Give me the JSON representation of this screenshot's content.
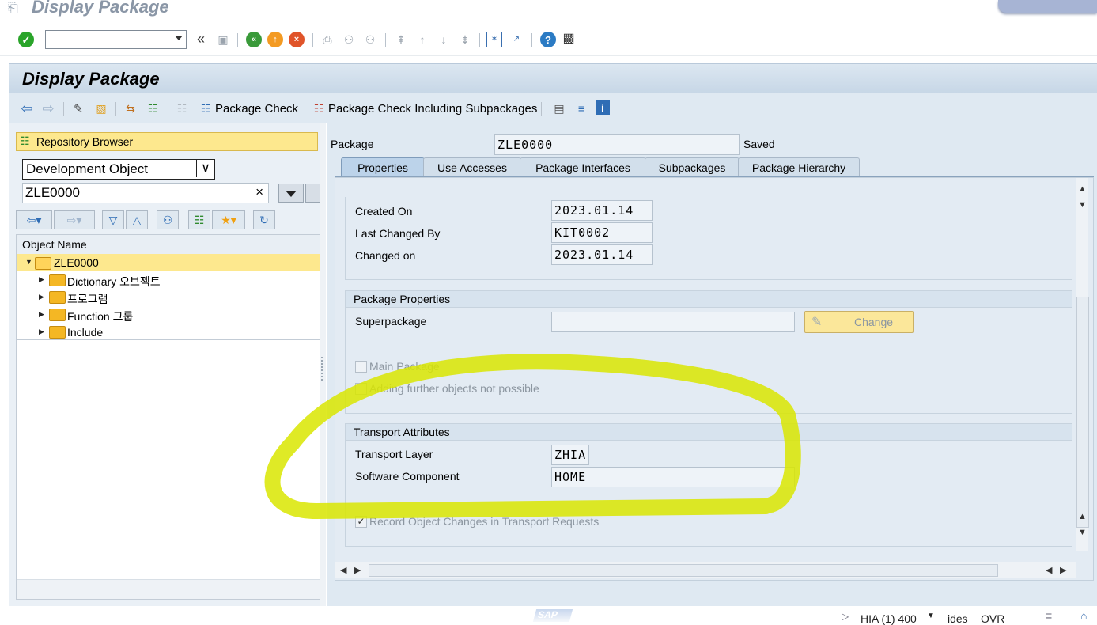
{
  "window": {
    "title": "Display Package"
  },
  "system_toolbar": {
    "command_field_value": ""
  },
  "title_bar": {
    "title": "Display Package"
  },
  "app_toolbar": {
    "package_check_label": "Package Check",
    "package_check_sub_label": "Package Check Including Subpackages"
  },
  "left_panel": {
    "repository_browser_label": "Repository Browser",
    "object_type_select": "Development Object",
    "object_input_value": "ZLE0000",
    "tree_header": "Object Name",
    "tree_root": "ZLE0000",
    "tree_items": [
      {
        "label": "Dictionary 오브젝트"
      },
      {
        "label": "프로그램"
      },
      {
        "label": "Function 그룹"
      },
      {
        "label": "Include"
      }
    ]
  },
  "right_panel": {
    "package_label": "Package",
    "package_value": "ZLE0000",
    "status": "Saved",
    "tabs": [
      {
        "label": "Properties",
        "active": true
      },
      {
        "label": "Use Accesses",
        "active": false
      },
      {
        "label": "Package Interfaces",
        "active": false
      },
      {
        "label": "Subpackages",
        "active": false
      },
      {
        "label": "Package Hierarchy",
        "active": false
      }
    ],
    "created_on_label": "Created On",
    "created_on_value": "2023.01.14",
    "last_changed_by_label": "Last Changed By",
    "last_changed_by_value": "KIT0002",
    "changed_on_label": "Changed on",
    "changed_on_value": "2023.01.14",
    "package_properties_header": "Package Properties",
    "superpackage_label": "Superpackage",
    "superpackage_value": "",
    "change_button_label": "Change",
    "main_package_label": "Main Package",
    "main_package_checked": false,
    "adding_objects_label": "Adding further objects not possible",
    "adding_objects_checked": false,
    "transport_attributes_header": "Transport Attributes",
    "transport_layer_label": "Transport Layer",
    "transport_layer_value": "ZHIA",
    "software_component_label": "Software Component",
    "software_component_value": "HOME",
    "record_changes_label": "Record Object Changes in Transport Requests",
    "record_changes_checked": true
  },
  "status_bar": {
    "system_info": "HIA (1) 400",
    "server": "ides",
    "mode": "OVR",
    "logo": "SAP"
  },
  "colors": {
    "highlight_scribble": "#d9e600",
    "selected_row": "#fde88e",
    "panel_bg": "#dfe9f2"
  },
  "icons": [
    "enter-icon",
    "back-nav-icon",
    "save-icon",
    "green-back-icon",
    "exit-icon",
    "cancel-icon",
    "print-icon",
    "find-icon",
    "find-next-icon",
    "first-page-icon",
    "prev-page-icon",
    "next-page-icon",
    "last-page-icon",
    "new-session-icon",
    "shortcut-icon",
    "help-icon",
    "customize-icon",
    "arrow-left-icon",
    "arrow-right-icon",
    "display-change-icon",
    "activate-icon",
    "where-used-icon",
    "hierarchy-icon",
    "package-check-icon",
    "info-icon"
  ]
}
